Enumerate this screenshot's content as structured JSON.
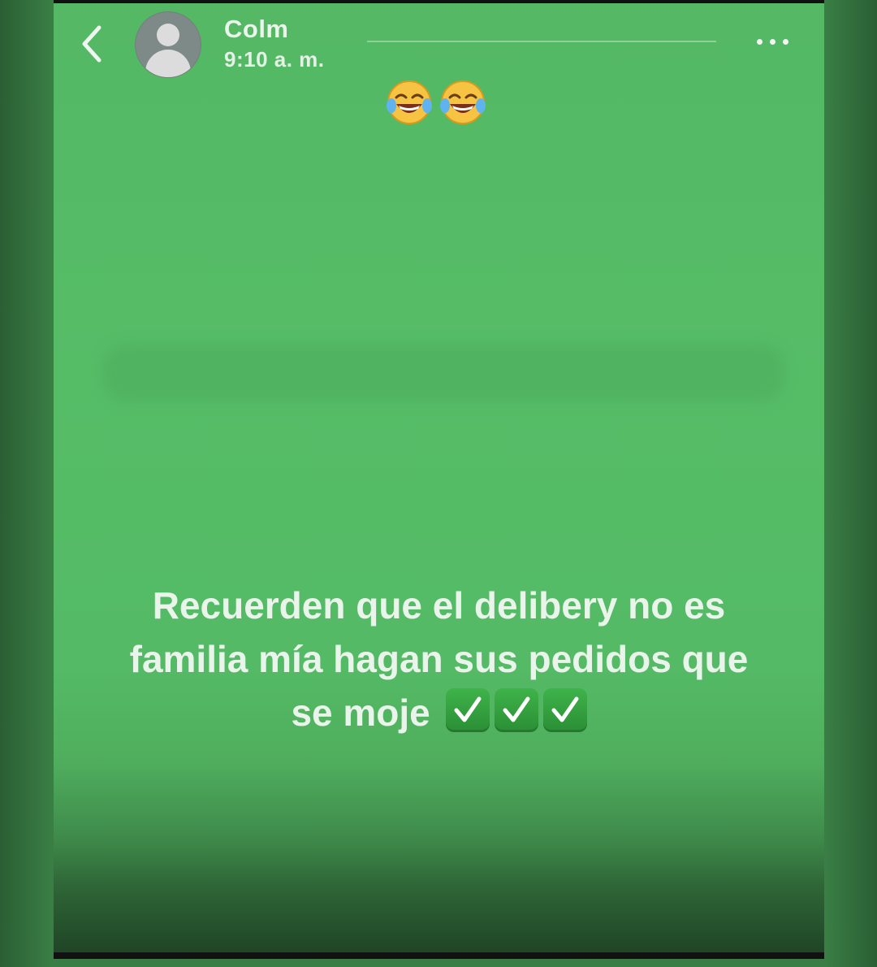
{
  "header": {
    "contact_name": "Colm",
    "timestamp": "9:10 a. m."
  },
  "icons": {
    "back": "chevron-left-icon",
    "avatar": "default-user-avatar",
    "more": "ellipsis-icon",
    "emoji_top": [
      "face-with-tears-of-joy",
      "face-with-tears-of-joy"
    ],
    "check_emoji": [
      "check-mark-button",
      "check-mark-button",
      "check-mark-button"
    ]
  },
  "caption": {
    "line1": "Recuerden que el delibery no es",
    "line2": "familia mía hagan sus pedidos que",
    "line3": "se moje"
  },
  "colors": {
    "background": "#56bd67",
    "text": "#e9f4ea",
    "check": "#2f9b3a"
  }
}
